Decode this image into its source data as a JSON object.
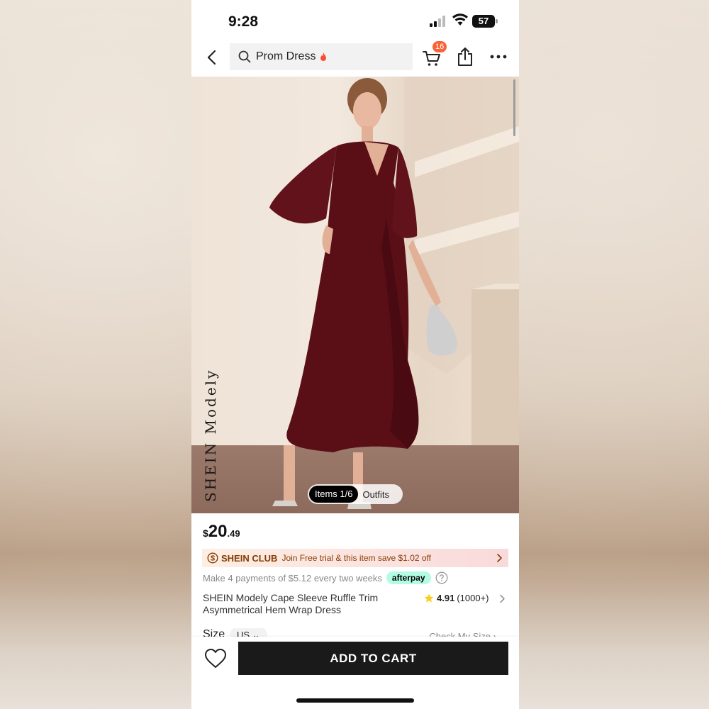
{
  "status_bar": {
    "time": "9:28",
    "battery": "57"
  },
  "search": {
    "query": "Prom Dress"
  },
  "cart": {
    "badge_count": "16"
  },
  "gallery": {
    "brand_mark": "SHEIN Modely",
    "tabs": [
      {
        "label": "Items 1/6",
        "selected": true
      },
      {
        "label": "Outfits",
        "selected": false
      }
    ]
  },
  "price": {
    "currency": "$",
    "integer": "20",
    "decimal": ".49"
  },
  "club_banner": {
    "name": "SHEIN CLUB",
    "text": "Join Free trial & this item save $1.02 off"
  },
  "installments": {
    "text": "Make 4 payments of $5.12 every two weeks",
    "provider": "afterpay"
  },
  "product": {
    "title": "SHEIN Modely Cape Sleeve Ruffle Trim Asymmetrical Hem Wrap Dress",
    "rating": "4.91",
    "review_count": "(1000+)"
  },
  "size": {
    "label": "Size",
    "selected": "US",
    "check_link": "Check My Size"
  },
  "bottom_bar": {
    "add_to_cart": "ADD TO CART"
  },
  "colors": {
    "dress": "#5a0f17",
    "club_text": "#873c00",
    "cart_badge": "#fa6338",
    "afterpay": "#b2fce4",
    "button": "#1a1a1a"
  }
}
